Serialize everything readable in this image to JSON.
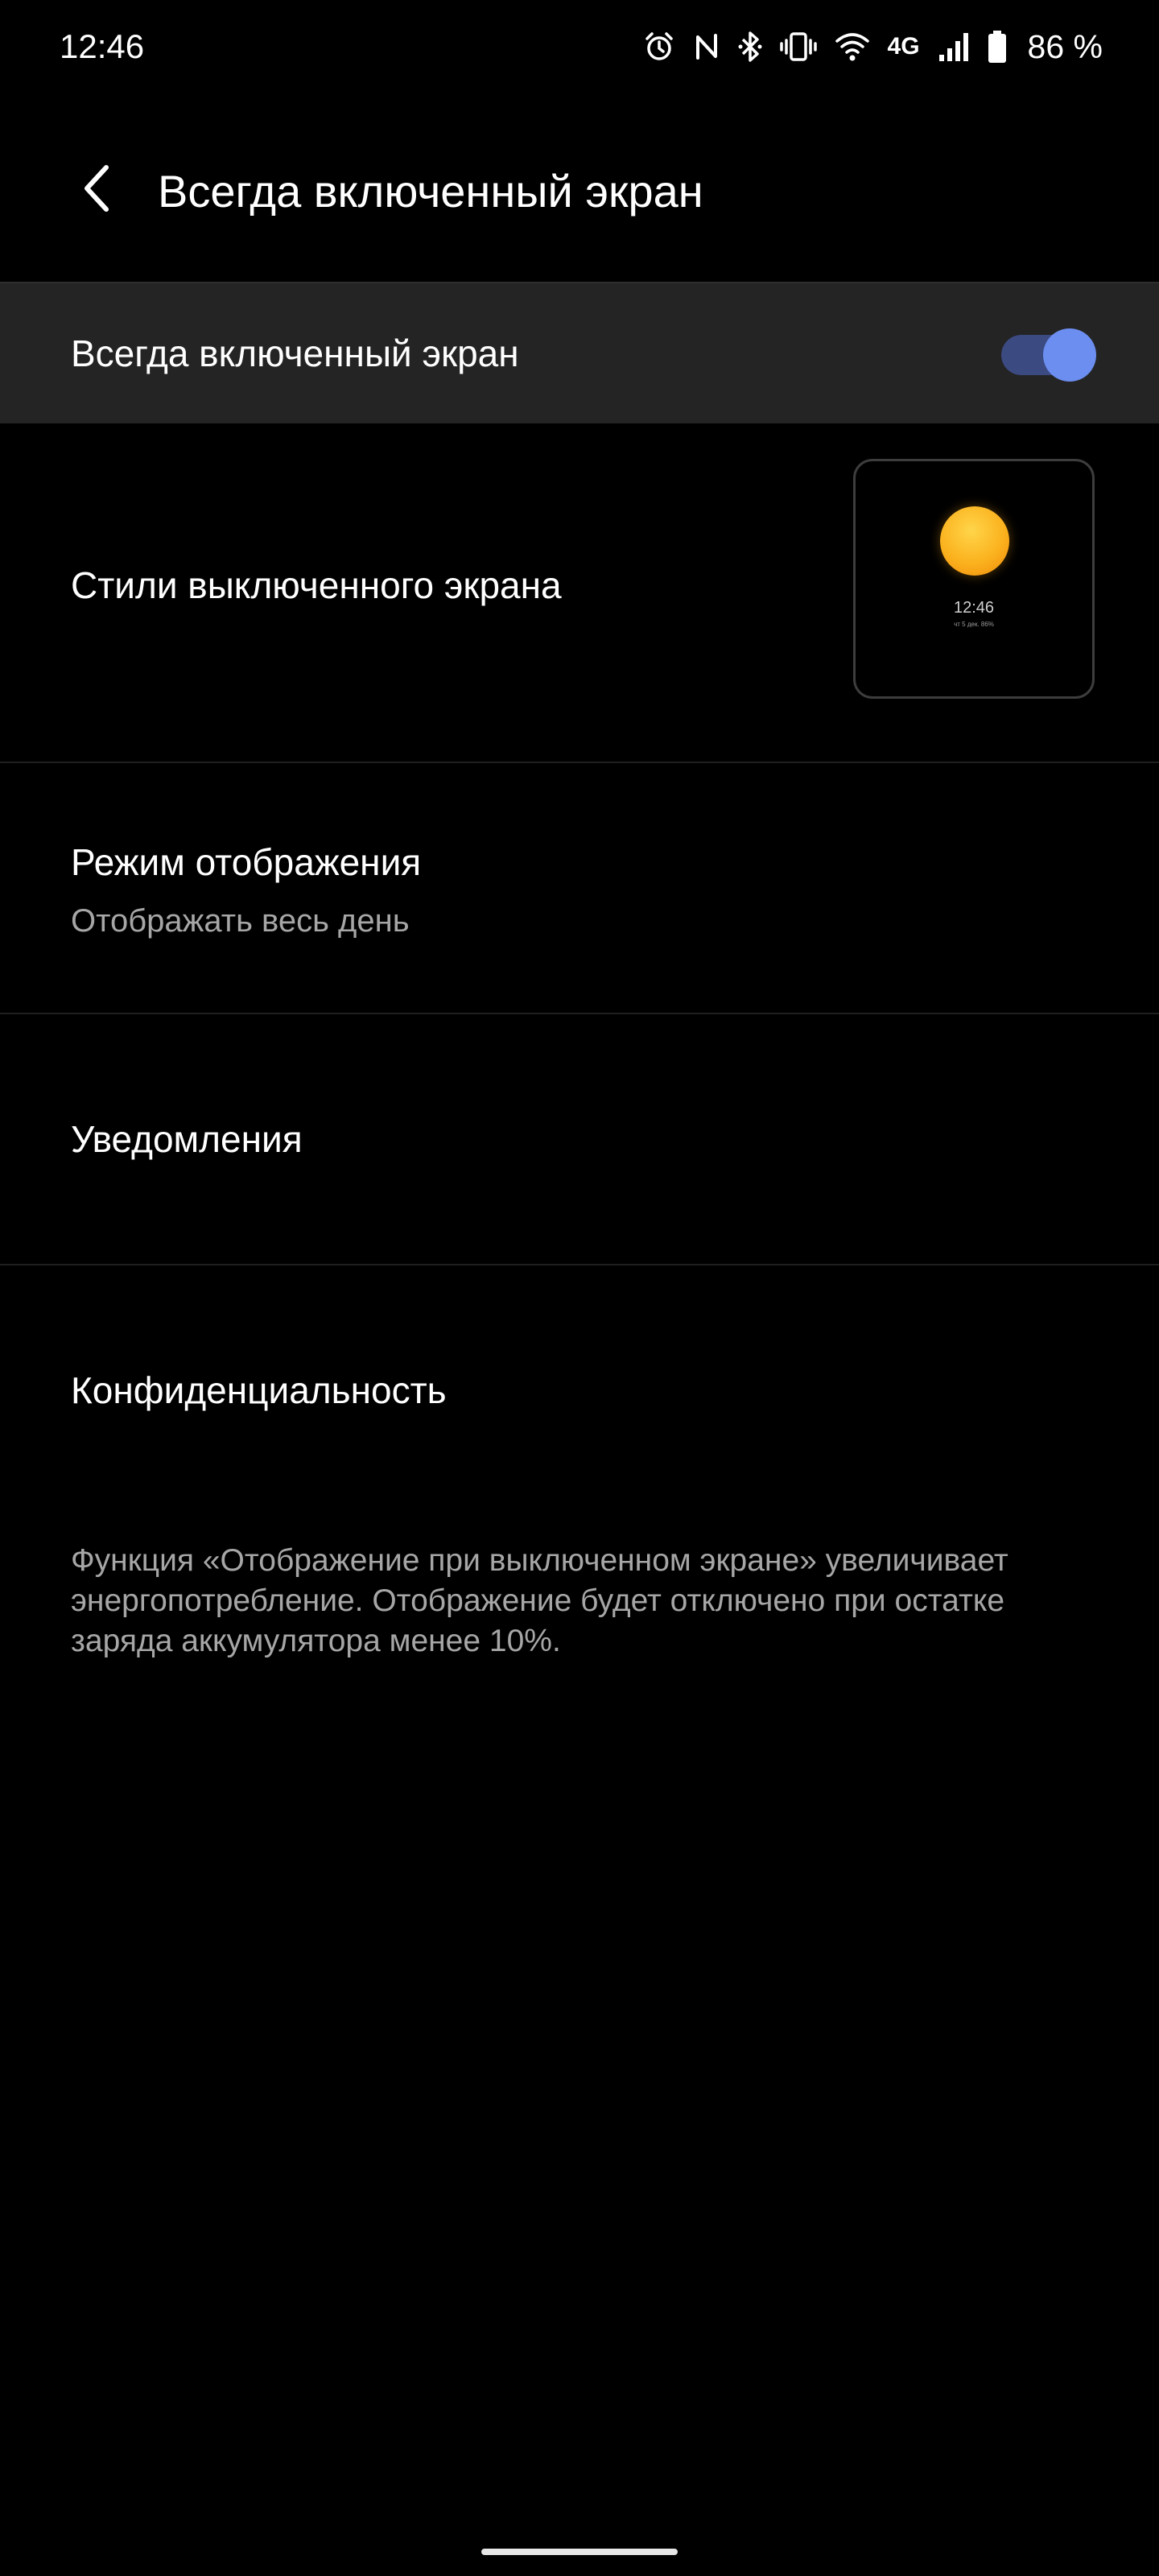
{
  "status_bar": {
    "time": "12:46",
    "network_label": "4G",
    "battery_percent": "86 %",
    "icons": [
      "alarm-icon",
      "nfc-icon",
      "bluetooth-icon",
      "vibrate-icon",
      "wifi-icon",
      "signal-icon",
      "battery-icon"
    ]
  },
  "app_bar": {
    "title": "Всегда включенный экран",
    "back_icon": "chevron-left-icon"
  },
  "main_switch": {
    "label": "Всегда включенный экран",
    "enabled": true,
    "accent_color": "#6b8ef0"
  },
  "rows": {
    "styles": {
      "title": "Стили выключенного экрана",
      "preview": {
        "time": "12:46",
        "date": "чт 5 дек. 86%"
      }
    },
    "display_mode": {
      "title": "Режим отображения",
      "subtitle": "Отображать весь день"
    },
    "notifications": {
      "title": "Уведомления"
    },
    "privacy": {
      "title": "Конфиденциальность"
    }
  },
  "footer_note": "Функция «Отображение при выключенном экране» увеличивает энергопотребление. Отображение будет отключено при остатке заряда аккумулятора менее 10%."
}
